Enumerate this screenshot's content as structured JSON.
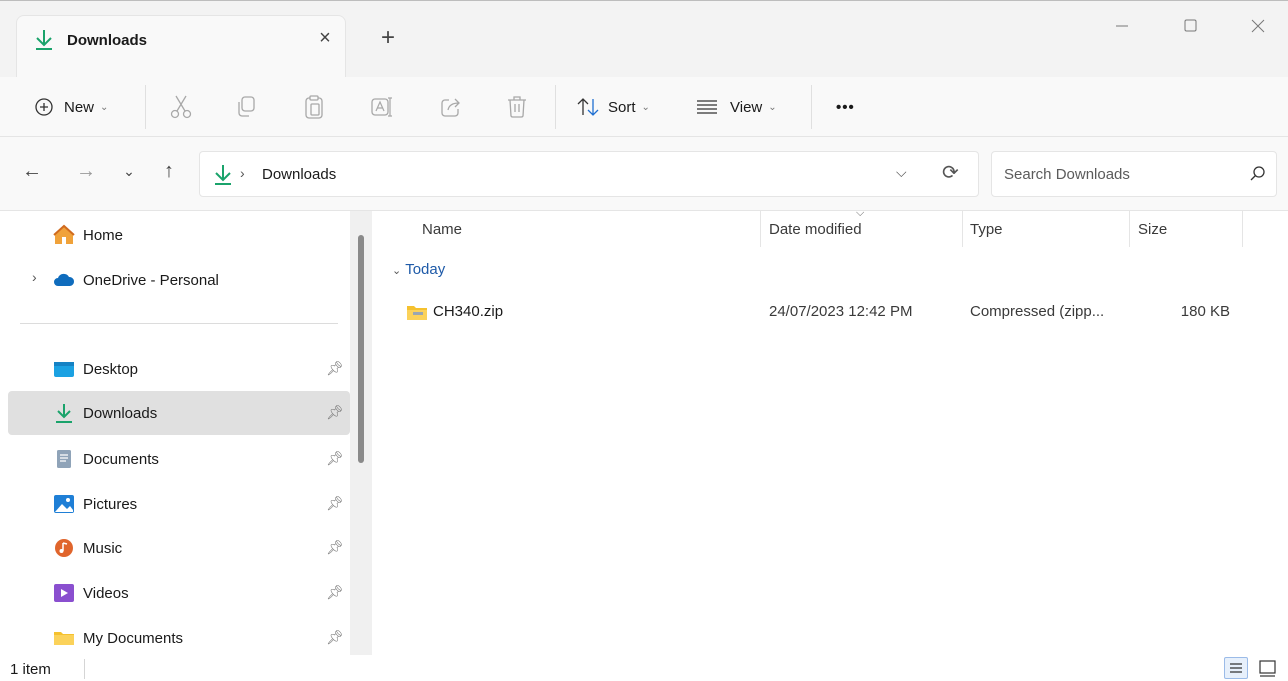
{
  "window": {
    "tab_title": "Downloads",
    "tab_close_glyph": "×",
    "new_tab_glyph": "+",
    "controls": {
      "minimize": "minimize-icon",
      "maximize": "maximize-icon",
      "close": "close-icon"
    }
  },
  "toolbar": {
    "new_label": "New",
    "sort_label": "Sort",
    "view_label": "View",
    "more_label": "•••"
  },
  "address": {
    "path": "Downloads",
    "separator": "›",
    "dropdown_glyph": "⌵",
    "refresh_glyph": "⟳"
  },
  "search": {
    "placeholder": "Search Downloads"
  },
  "sidebar": {
    "items": [
      {
        "label": "Home"
      },
      {
        "label": "OneDrive - Personal"
      },
      {
        "label": "Desktop"
      },
      {
        "label": "Downloads"
      },
      {
        "label": "Documents"
      },
      {
        "label": "Pictures"
      },
      {
        "label": "Music"
      },
      {
        "label": "Videos"
      },
      {
        "label": "My Documents"
      }
    ]
  },
  "columns": {
    "name": "Name",
    "date_modified": "Date modified",
    "type": "Type",
    "size": "Size"
  },
  "groups": [
    {
      "label": "Today",
      "files": [
        {
          "name": "CH340.zip",
          "date": "24/07/2023 12:42 PM",
          "type": "Compressed (zipp...",
          "size": "180 KB"
        }
      ]
    }
  ],
  "status": {
    "item_count": "1 item"
  },
  "colors": {
    "accent_green": "#1aa36b",
    "onedrive_blue": "#0f6cbd",
    "group_blue": "#1e5aa8",
    "selected_bg": "#e0e0e0"
  }
}
